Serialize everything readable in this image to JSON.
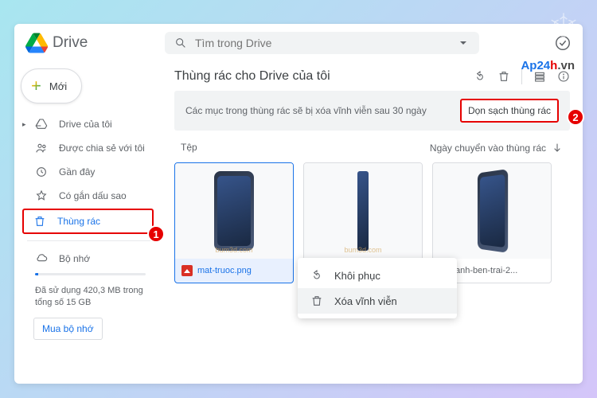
{
  "header": {
    "appName": "Drive",
    "searchPlaceholder": "Tìm trong Drive"
  },
  "brand": {
    "p1": "Ap24",
    "p2": "h",
    "p3": ".vn"
  },
  "sidebar": {
    "newLabel": "Mới",
    "items": [
      {
        "label": "Drive của tôi",
        "icon": "drive"
      },
      {
        "label": "Được chia sẻ với tôi",
        "icon": "shared"
      },
      {
        "label": "Gần đây",
        "icon": "recent"
      },
      {
        "label": "Có gắn dấu sao",
        "icon": "star"
      },
      {
        "label": "Thùng rác",
        "icon": "trash"
      },
      {
        "label": "Bộ nhớ",
        "icon": "cloud"
      }
    ],
    "storageText": "Đã sử dụng 420,3 MB trong tổng số 15 GB",
    "buyLabel": "Mua bộ nhớ"
  },
  "main": {
    "title": "Thùng rác cho Drive của tôi",
    "noticeText": "Các mục trong thùng rác sẽ bị xóa vĩnh viễn sau 30 ngày",
    "emptyTrashLabel": "Dọn sạch thùng rác",
    "filesSectionLabel": "Tệp",
    "sortLabel": "Ngày chuyển vào thùng rác",
    "files": [
      {
        "name": "mat-truoc.png"
      },
      {
        "name": ""
      },
      {
        "name": "anh-ben-trai-2..."
      }
    ]
  },
  "contextMenu": {
    "restore": "Khôi phục",
    "deleteForever": "Xóa vĩnh viễn"
  },
  "thumbWatermark": "bum3d.com",
  "annotations": {
    "badge1": "1",
    "badge2": "2"
  }
}
